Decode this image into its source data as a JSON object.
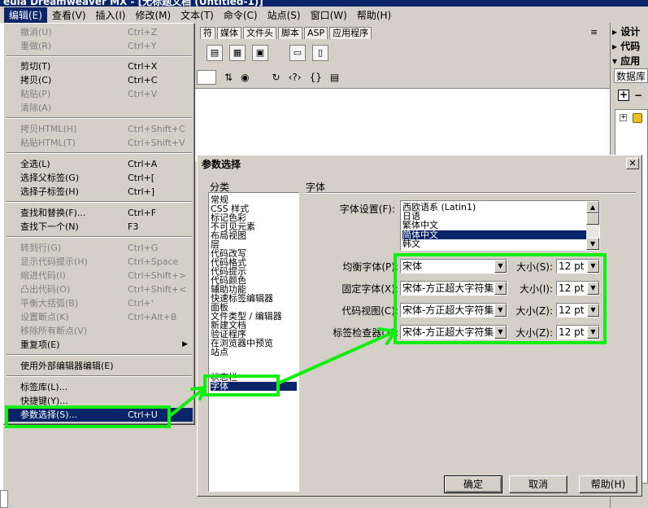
{
  "window": {
    "title": "euia Dreamweaver MX - [无标题文档 (Untitled-1)]"
  },
  "menubar": [
    "编辑(E)",
    "查看(V)",
    "插入(I)",
    "修改(M)",
    "文本(T)",
    "命令(C)",
    "站点(S)",
    "窗口(W)",
    "帮助(H)"
  ],
  "doc_tabs": [
    "符",
    "媒体",
    "文件头",
    "脚本",
    "ASP",
    "应用程序"
  ],
  "right_panel": {
    "headers": [
      "▸ 设计",
      "▸ 代码",
      "▾ 应用"
    ],
    "db_tab": "数据库",
    "plus": "+",
    "minus": "−",
    "tree_node": "+"
  },
  "edit_menu": [
    {
      "label": "撤消(U)",
      "shortcut": "Ctrl+Z",
      "disabled": true
    },
    {
      "label": "重做(R)",
      "shortcut": "Ctrl+Y",
      "disabled": true
    },
    {
      "label": "剪切(T)",
      "shortcut": "Ctrl+X",
      "disabled": false
    },
    {
      "label": "拷贝(C)",
      "shortcut": "Ctrl+C",
      "disabled": false
    },
    {
      "label": "粘贴(P)",
      "shortcut": "Ctrl+V",
      "disabled": true
    },
    {
      "label": "清除(A)",
      "shortcut": "",
      "disabled": true
    },
    {
      "label": "拷贝HTML(H)",
      "shortcut": "Ctrl+Shift+C",
      "disabled": true
    },
    {
      "label": "粘贴HTML(T)",
      "shortcut": "Ctrl+Shift+V",
      "disabled": true
    },
    {
      "label": "全选(L)",
      "shortcut": "Ctrl+A",
      "disabled": false
    },
    {
      "label": "选择父标签(G)",
      "shortcut": "Ctrl+[",
      "disabled": false
    },
    {
      "label": "选择子标签(H)",
      "shortcut": "Ctrl+]",
      "disabled": false
    },
    {
      "label": "查找和替换(F)...",
      "shortcut": "Ctrl+F",
      "disabled": false
    },
    {
      "label": "查找下一个(N)",
      "shortcut": "F3",
      "disabled": false
    },
    {
      "label": "转到行(G)",
      "shortcut": "Ctrl+G",
      "disabled": true
    },
    {
      "label": "显示代码提示(H)",
      "shortcut": "Ctrl+Space",
      "disabled": true
    },
    {
      "label": "缩进代码(I)",
      "shortcut": "Ctrl+Shift+>",
      "disabled": true
    },
    {
      "label": "凸出代码(O)",
      "shortcut": "Ctrl+Shift+<",
      "disabled": true
    },
    {
      "label": "平衡大括弧(B)",
      "shortcut": "Ctrl+'",
      "disabled": true
    },
    {
      "label": "设置断点(K)",
      "shortcut": "Ctrl+Alt+B",
      "disabled": true
    },
    {
      "label": "移除所有断点(V)",
      "shortcut": "",
      "disabled": true
    },
    {
      "label": "重复项(E)",
      "shortcut": "",
      "disabled": false,
      "submenu": true
    },
    {
      "label": "使用外部编辑器编辑(E)",
      "shortcut": "",
      "disabled": false
    },
    {
      "label": "标签库(L)...",
      "shortcut": "",
      "disabled": false
    },
    {
      "label": "快捷键(Y)...",
      "shortcut": "",
      "disabled": false
    },
    {
      "label": "参数选择(S)...",
      "shortcut": "Ctrl+U",
      "disabled": false,
      "selected": true
    }
  ],
  "dialog": {
    "title": "参数选择",
    "close": "✕",
    "category_label": "分类",
    "categories": [
      "常规",
      "CSS 样式",
      "标记色彩",
      "不可见元素",
      "布局视图",
      "层",
      "代码改写",
      "代码格式",
      "代码提示",
      "代码颜色",
      "辅助功能",
      "快速标签编辑器",
      "面板",
      "文件类型 / 编辑器",
      "新建文档",
      "验证程序",
      "在浏览器中预览",
      "站点",
      "状态栏",
      "字体"
    ],
    "selected_category": "字体",
    "section_title": "字体",
    "font_settings_label": "字体设置(F):",
    "font_settings": [
      "西欧语系 (Latin1)",
      "日语",
      "繁体中文",
      "简体中文",
      "韩文"
    ],
    "selected_font_setting": "简体中文",
    "rows": [
      {
        "label": "均衡字体(P):",
        "font": "宋体",
        "size_label": "大小(S):",
        "size": "12 pt"
      },
      {
        "label": "固定字体(X):",
        "font": "宋体-方正超大字符集",
        "size_label": "大小(I):",
        "size": "12 pt"
      },
      {
        "label": "代码视图(C):",
        "font": "宋体-方正超大字符集",
        "size_label": "大小(Z):",
        "size": "12 pt"
      },
      {
        "label": "标签检查器(T):",
        "font": "宋体-方正超大字符集",
        "size_label": "大小(Z):",
        "size": "12 pt"
      }
    ],
    "buttons": {
      "ok": "确定",
      "cancel": "取消",
      "help": "帮助(H)"
    }
  },
  "colors": {
    "highlight": "#11ee11",
    "selection": "#0a246a"
  }
}
